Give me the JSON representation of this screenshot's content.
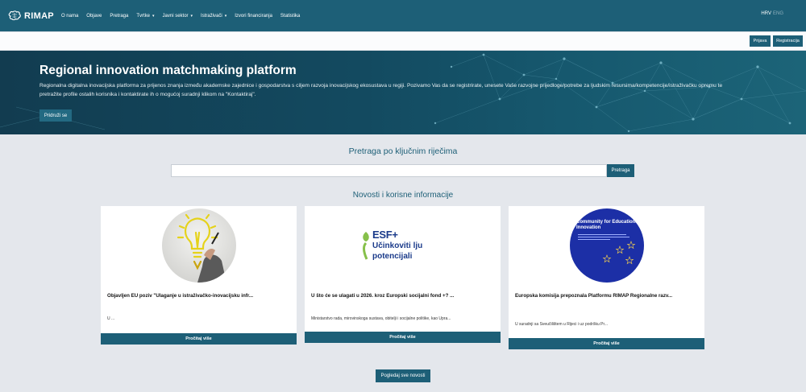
{
  "app": {
    "logo_text": "RIMAP"
  },
  "nav": {
    "items": [
      {
        "label": "O nama",
        "dropdown": false
      },
      {
        "label": "Objave",
        "dropdown": false
      },
      {
        "label": "Pretraga",
        "dropdown": false
      },
      {
        "label": "Tvrtke",
        "dropdown": true
      },
      {
        "label": "Javni sektor",
        "dropdown": true
      },
      {
        "label": "Istraživači",
        "dropdown": true
      },
      {
        "label": "Izvori financiranja",
        "dropdown": false
      },
      {
        "label": "Statistika",
        "dropdown": false
      }
    ],
    "lang_current": "HRV",
    "lang_alt": "ENG"
  },
  "auth": {
    "login_label": "Prijava",
    "register_label": "Registracija"
  },
  "hero": {
    "title": "Regional innovation matchmaking platform",
    "description": "Regionalna digitalna inovacijska platforma za prijenos znanja između akademske zajednice i gospodarstva s ciljem razvoja inovacijskog ekosustava u regiji. Pozivamo Vas da se registrirate, unesete Vaše razvojne prijedloge/potrebe za ljudskim resursima/kompetencije/istraživačku opremu te pretražite profile ostalih korisnika i kontaktirate ih o mogućoj suradnji klikom na \"Kontaktiraj\".",
    "join_label": "Pridruži se"
  },
  "search": {
    "title": "Pretraga po ključnim riječima",
    "value": "",
    "placeholder": "",
    "button_label": "Pretraga"
  },
  "news": {
    "title": "Novosti i korisne informacije",
    "cards": [
      {
        "title": "Objavljen EU poziv \"Ulaganje u istraživačko-inovacijsku infr...",
        "excerpt": "U ...",
        "button_label": "Pročitaj više"
      },
      {
        "title": "U što će se ulagati u 2026. kroz Europski socijalni fond +? ...",
        "excerpt": "Ministarstvo rada, mirovinskoga sustava, obitelji i socijalne politike, kao Upra...",
        "button_label": "Pročitaj više",
        "logo_line1": "ESF+",
        "logo_line2": "Učinkoviti lju",
        "logo_line3": "potencijali"
      },
      {
        "title": "Europska komisija prepoznala Platformu RIMAP Regionalne razv...",
        "excerpt": "U suradnji sa Sveučilištem u Rijeci i uz podršku Pr...",
        "button_label": "Pročitaj više",
        "image_heading": "Community for Educational Innovation"
      }
    ],
    "all_news_label": "Pogledaj sve novosti"
  },
  "colors": {
    "primary": "#1d5f77",
    "page_bg": "#e4e7ec",
    "hero_dark": "#123c50"
  }
}
